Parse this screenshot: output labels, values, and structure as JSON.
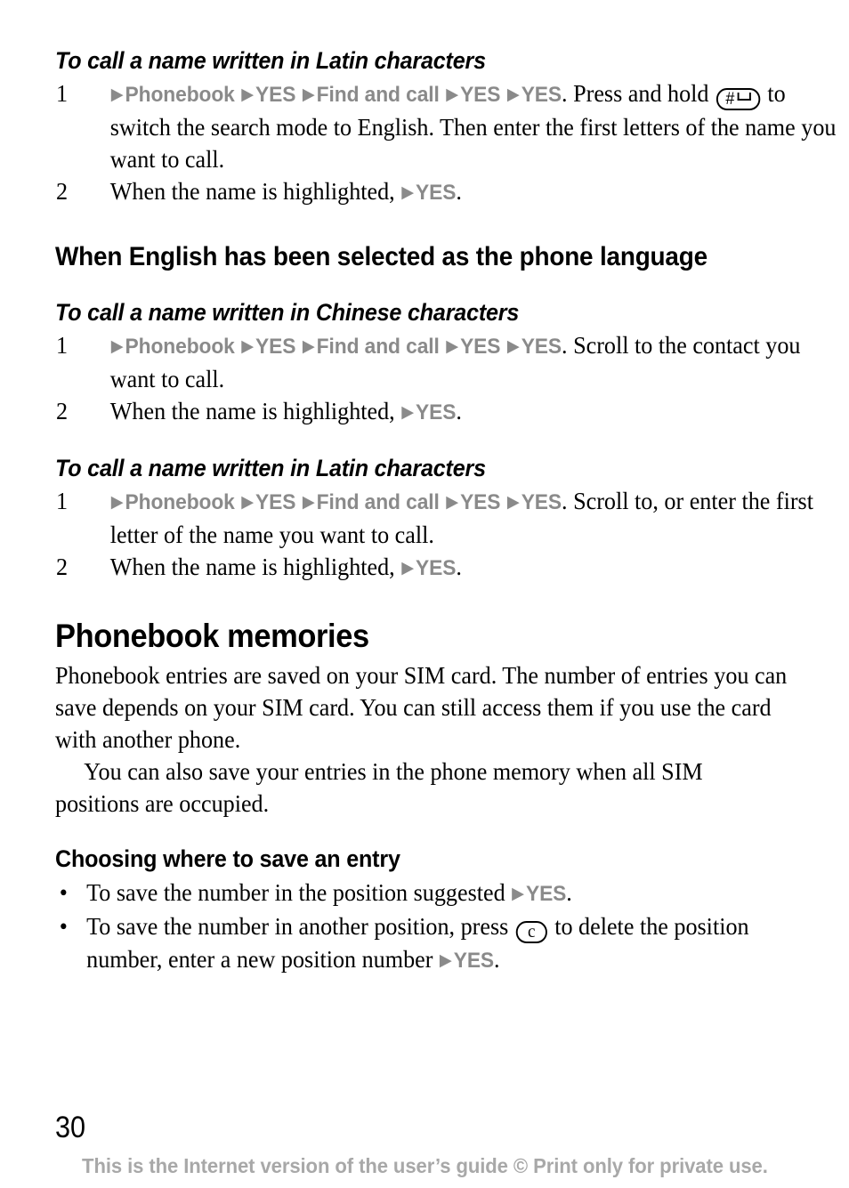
{
  "page": {
    "number": "30",
    "footer_note": "This is the Internet version of the user’s guide © Print only for private use.",
    "ui_token_color": "#8a8a8a",
    "footer_color": "#a8a8a8",
    "text_color": "#000000",
    "background_color": "#ffffff"
  },
  "tokens": {
    "phonebook": "Phonebook",
    "yes": "YES",
    "find_and_call": "Find and call",
    "arrow": "▶",
    "bullet": "•",
    "key_hash": "#",
    "key_c": "c"
  },
  "sections": [
    {
      "id": "latin-top",
      "proc_title": "To call a name written in Latin characters",
      "steps": [
        {
          "number": "1",
          "text_after_path": ". Press and hold ",
          "text_after_key": " to switch the search mode to English. Then enter the first letters of the name you want to call."
        },
        {
          "number": "2",
          "lead": "When the name is highlighted, ",
          "trail": "."
        }
      ]
    },
    {
      "id": "english-selected",
      "heading": "When English has been selected as the phone language"
    },
    {
      "id": "chinese",
      "proc_title": "To call a name written in Chinese characters",
      "steps": [
        {
          "number": "1",
          "text_after_path": ". Scroll to the contact you want to call."
        },
        {
          "number": "2",
          "lead": "When the name is highlighted, ",
          "trail": "."
        }
      ]
    },
    {
      "id": "latin-bottom",
      "proc_title": "To call a name written in Latin characters",
      "steps": [
        {
          "number": "1",
          "text_after_path": ". Scroll to, or enter the first letter of the name you want to call."
        },
        {
          "number": "2",
          "lead": "When the name is highlighted, ",
          "trail": "."
        }
      ]
    },
    {
      "id": "phonebook-memories",
      "heading": "Phonebook memories",
      "paragraphs": [
        "Phonebook entries are saved on your SIM card. The number of entries you can save depends on your SIM card. You can still access them if you use the card with another phone.",
        "You can also save your entries in the phone memory when all SIM positions are occupied."
      ]
    },
    {
      "id": "choosing-where",
      "heading": "Choosing where to save an entry",
      "bullets": [
        {
          "lead": "To save the number in the position suggested ",
          "trail": "."
        },
        {
          "lead": "To save the number in another position, press ",
          "mid": " to delete the position number, enter a new position number ",
          "trail": "."
        }
      ]
    }
  ]
}
